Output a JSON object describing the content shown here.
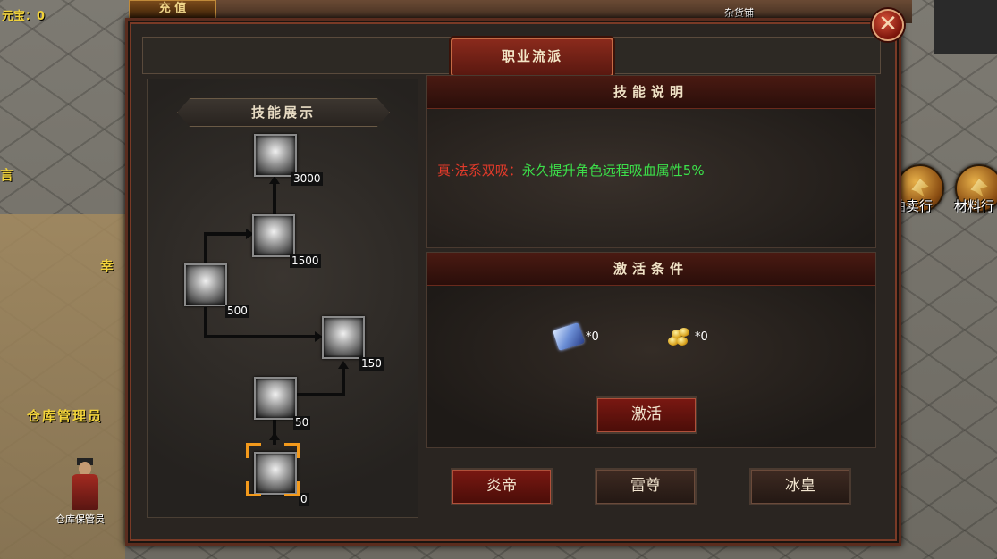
{
  "hud": {
    "currency_label": "元宝：",
    "currency_value": "0",
    "top_button": "充 值",
    "shop_name": "杂货铺",
    "npc_name_overhead": "仓库管理员",
    "npc_name": "仓库保管员",
    "left_partial_text": "幸",
    "left_partial_text2": "言"
  },
  "side_buttons": [
    {
      "label": "拍卖行",
      "icon": "auction-icon"
    },
    {
      "label": "材料行",
      "icon": "material-icon"
    }
  ],
  "panel": {
    "title": "职业流派",
    "close_glyph": "✕"
  },
  "skill_tree": {
    "header": "技能展示",
    "nodes": [
      {
        "id": "node-top",
        "cost": "3000"
      },
      {
        "id": "node-upper-right",
        "cost": "1500"
      },
      {
        "id": "node-left",
        "cost": "500"
      },
      {
        "id": "node-mid-right",
        "cost": "150"
      },
      {
        "id": "node-lower",
        "cost": "50"
      },
      {
        "id": "node-base",
        "cost": "0"
      }
    ]
  },
  "description": {
    "header": "技能说明",
    "skill_name": "真·法系双吸：",
    "skill_effect": "永久提升角色远程吸血属性5%"
  },
  "activation": {
    "header": "激活条件",
    "items": [
      {
        "icon": "scroll-icon",
        "count": "*0"
      },
      {
        "icon": "gold-coins-icon",
        "count": "*0"
      }
    ],
    "activate_button": "激活"
  },
  "class_tabs": [
    {
      "label": "炎帝",
      "active": true
    },
    {
      "label": "雷尊",
      "active": false
    },
    {
      "label": "冰皇",
      "active": false
    }
  ],
  "colors": {
    "skill_name": "#e23a2a",
    "skill_effect": "#3ce04a",
    "selection_frame": "#f39a1c",
    "accent_red": "#7a1812"
  }
}
